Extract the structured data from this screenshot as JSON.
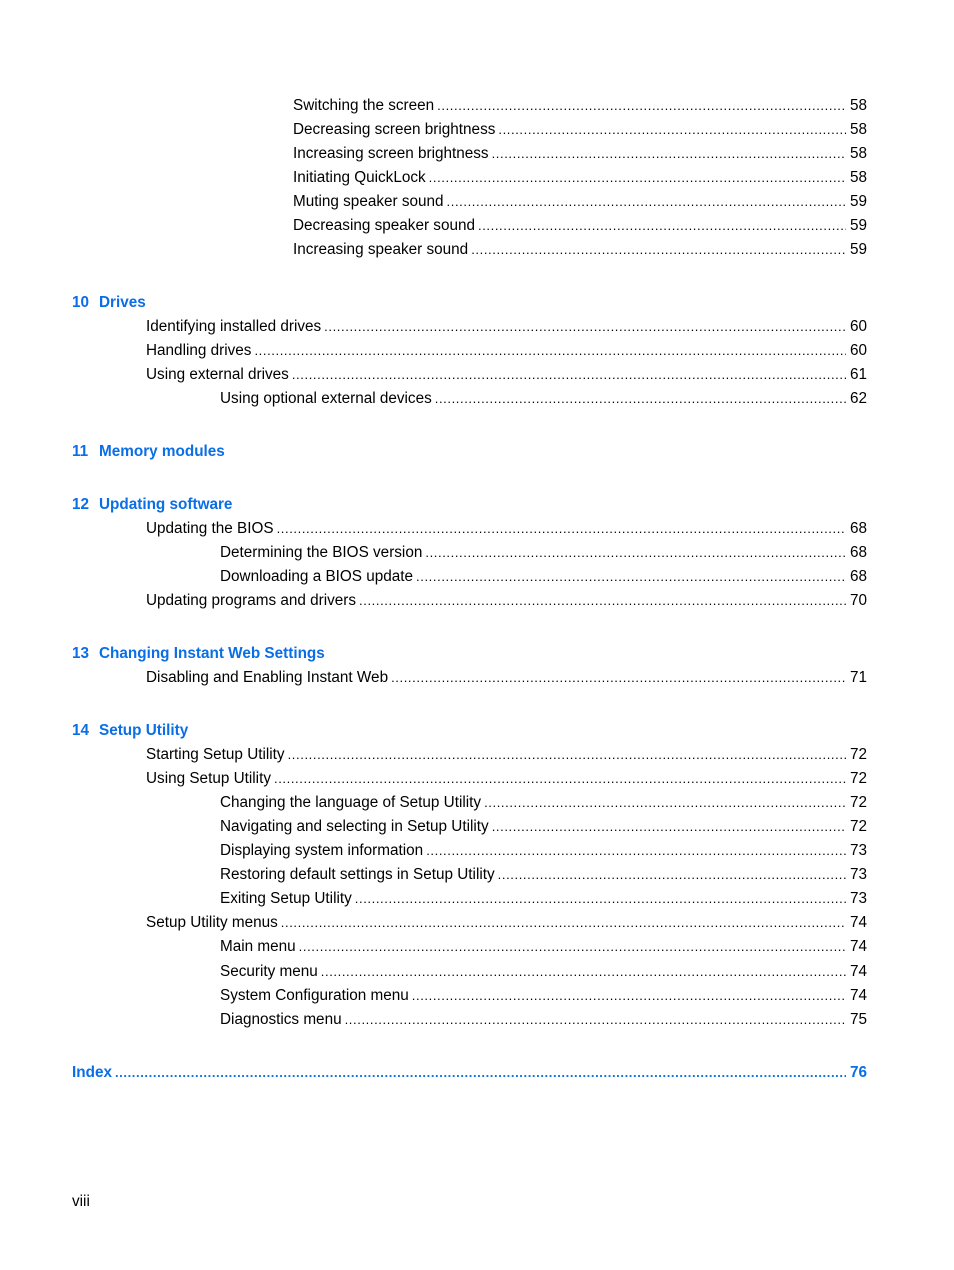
{
  "colors": {
    "heading": "#0a6ee6",
    "text": "#000000"
  },
  "pre_entries": [
    {
      "title": "Switching the screen ",
      "page": "58"
    },
    {
      "title": "Decreasing screen brightness",
      "page": "58"
    },
    {
      "title": "Increasing screen brightness",
      "page": "58"
    },
    {
      "title": "Initiating QuickLock",
      "page": "58"
    },
    {
      "title": "Muting speaker sound",
      "page": "59"
    },
    {
      "title": "Decreasing speaker sound",
      "page": "59"
    },
    {
      "title": "Increasing speaker sound",
      "page": "59"
    }
  ],
  "chapters": [
    {
      "number": "10",
      "title": "Drives",
      "entries": [
        {
          "title": "Identifying installed drives",
          "page": "60",
          "level": 1
        },
        {
          "title": "Handling drives",
          "page": "60",
          "level": 1
        },
        {
          "title": "Using external drives",
          "page": "61",
          "level": 1
        },
        {
          "title": "Using optional external devices",
          "page": "62",
          "level": 2
        }
      ]
    },
    {
      "number": "11",
      "title": "Memory modules",
      "entries": []
    },
    {
      "number": "12",
      "title": "Updating software",
      "entries": [
        {
          "title": "Updating the BIOS",
          "page": "68",
          "level": 1
        },
        {
          "title": "Determining the BIOS version",
          "page": "68",
          "level": 2
        },
        {
          "title": "Downloading a BIOS update",
          "page": "68",
          "level": 2
        },
        {
          "title": "Updating programs and drivers",
          "page": "70",
          "level": 1
        }
      ]
    },
    {
      "number": "13",
      "title": "Changing Instant Web Settings",
      "entries": [
        {
          "title": "Disabling and Enabling Instant Web",
          "page": "71",
          "level": 1
        }
      ]
    },
    {
      "number": "14",
      "title": "Setup Utility",
      "entries": [
        {
          "title": "Starting Setup Utility",
          "page": "72",
          "level": 1
        },
        {
          "title": "Using Setup Utility",
          "page": "72",
          "level": 1
        },
        {
          "title": "Changing the language of Setup Utility",
          "page": "72",
          "level": 2
        },
        {
          "title": "Navigating and selecting in Setup Utility",
          "page": "72",
          "level": 2
        },
        {
          "title": "Displaying system information",
          "page": "73",
          "level": 2
        },
        {
          "title": "Restoring default settings in Setup Utility",
          "page": "73",
          "level": 2
        },
        {
          "title": "Exiting Setup Utility",
          "page": "73",
          "level": 2
        },
        {
          "title": "Setup Utility menus",
          "page": "74",
          "level": 1
        },
        {
          "title": "Main menu",
          "page": "74",
          "level": 2
        },
        {
          "title": "Security menu",
          "page": "74",
          "level": 2
        },
        {
          "title": "System Configuration menu",
          "page": "74",
          "level": 2
        },
        {
          "title": "Diagnostics menu",
          "page": "75",
          "level": 2
        }
      ]
    }
  ],
  "index": {
    "title": "Index",
    "page": "76"
  },
  "footer": {
    "page_label": "viii"
  }
}
